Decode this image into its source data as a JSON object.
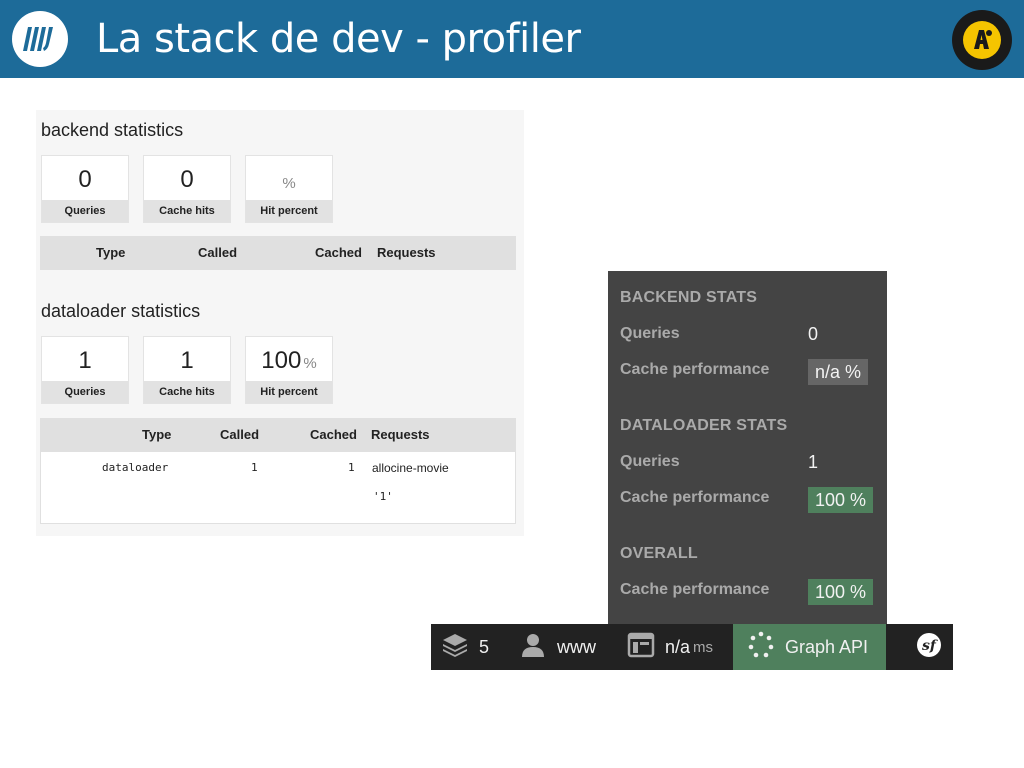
{
  "slide": {
    "title": "La stack de dev - profiler"
  },
  "icons": {
    "left_logo": "eleven-labs-logo-icon",
    "right_logo": "allocine-logo-icon",
    "toolbar": [
      "layers-icon",
      "user-icon",
      "timer-icon",
      "graph-dots-icon",
      "symfony-logo-icon"
    ]
  },
  "backend": {
    "title": "backend statistics",
    "metrics": [
      {
        "value": "0",
        "unit": "",
        "label": "Queries"
      },
      {
        "value": "0",
        "unit": "",
        "label": "Cache hits"
      },
      {
        "value": "",
        "unit": "%",
        "label": "Hit percent"
      }
    ],
    "columns": [
      "Type",
      "Called",
      "Cached",
      "Requests"
    ]
  },
  "dataloader": {
    "title": "dataloader statistics",
    "metrics": [
      {
        "value": "1",
        "unit": "",
        "label": "Queries"
      },
      {
        "value": "1",
        "unit": "",
        "label": "Cache hits"
      },
      {
        "value": "100",
        "unit": "%",
        "label": "Hit percent"
      }
    ],
    "columns": [
      "Type",
      "Called",
      "Cached",
      "Requests"
    ],
    "rows": [
      {
        "type": "dataloader",
        "called": "1",
        "cached": "1",
        "request": "allocine-movie",
        "request_arg": "'1'"
      }
    ]
  },
  "panel": {
    "backend_heading": "BACKEND STATS",
    "backend_queries_label": "Queries",
    "backend_queries_value": "0",
    "backend_cache_label": "Cache performance",
    "backend_cache_value": "n/a %",
    "dataloader_heading": "DATALOADER STATS",
    "dataloader_queries_label": "Queries",
    "dataloader_queries_value": "1",
    "dataloader_cache_label": "Cache performance",
    "dataloader_cache_value": "100 %",
    "overall_heading": "OVERALL",
    "overall_cache_label": "Cache performance",
    "overall_cache_value": "100 %"
  },
  "toolbar": {
    "layers_count": "5",
    "user": "www",
    "time_value": "n/a",
    "time_unit": "ms",
    "graph_label": "Graph API"
  },
  "colors": {
    "header_blue": "#1d6b99",
    "panel_dark": "#444444",
    "toolbar_dark": "#222222",
    "success_green": "#4f805d",
    "badge_gray": "#666666"
  }
}
